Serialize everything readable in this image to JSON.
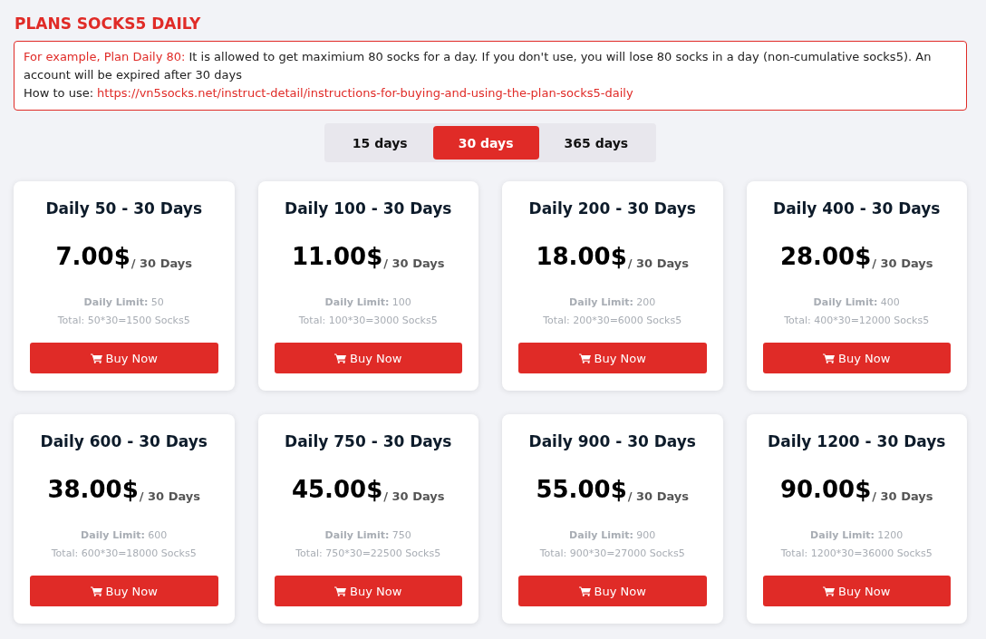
{
  "title": "PLANS SOCKS5 DAILY",
  "notice": {
    "description": "**For example, Plan Daily 80:** It is allowed to get maximium 80 socks for a day. If you don't use, you will lose 80 socks in a day (non-cumulative socks5). An account will be expired after 30 days",
    "how_to_label": "How to use:",
    "link": "https://vn5socks.net/instruct-detail/instructions-for-buying-and-using-the-plan-socks5-daily"
  },
  "tabs": [
    {
      "label": "15 days",
      "selected": false
    },
    {
      "label": "30 days",
      "selected": true
    },
    {
      "label": "365 days",
      "selected": false
    }
  ],
  "plans": [
    {
      "name": "Daily 50 - 30 Days",
      "price": "7.00$",
      "period": "/ 30 Days",
      "limit": "**Daily Limit:** 50",
      "total": "Total: 50*30=1500 Socks5",
      "button": "Buy Now"
    },
    {
      "name": "Daily 100 - 30 Days",
      "price": "11.00$",
      "period": "/ 30 Days",
      "limit": "**Daily Limit:** 100",
      "total": "Total: 100*30=3000 Socks5",
      "button": "Buy Now"
    },
    {
      "name": "Daily 200 - 30 Days",
      "price": "18.00$",
      "period": "/ 30 Days",
      "limit": "**Daily Limit:** 200",
      "total": "Total: 200*30=6000 Socks5",
      "button": "Buy Now"
    },
    {
      "name": "Daily 400 - 30 Days",
      "price": "28.00$",
      "period": "/ 30 Days",
      "limit": "**Daily Limit:** 400",
      "total": "Total: 400*30=12000 Socks5",
      "button": "Buy Now"
    },
    {
      "name": "Daily 600 - 30 Days",
      "price": "38.00$",
      "period": "/ 30 Days",
      "limit": "**Daily Limit:** 600",
      "total": "Total: 600*30=18000 Socks5",
      "button": "Buy Now"
    },
    {
      "name": "Daily 750 - 30 Days",
      "price": "45.00$",
      "period": "/ 30 Days",
      "limit": "**Daily Limit:** 750",
      "total": "Total: 750*30=22500 Socks5",
      "button": "Buy Now"
    },
    {
      "name": "Daily 900 - 30 Days",
      "price": "55.00$",
      "period": "/ 30 Days",
      "limit": "**Daily Limit:** 900",
      "total": "Total: 900*30=27000 Socks5",
      "button": "Buy Now"
    },
    {
      "name": "Daily 1200 - 30 Days",
      "price": "90.00$",
      "period": "/ 30 Days",
      "limit": "**Daily Limit:** 1200",
      "total": "Total: 1200*30=36000 Socks5",
      "button": "Buy Now"
    }
  ]
}
